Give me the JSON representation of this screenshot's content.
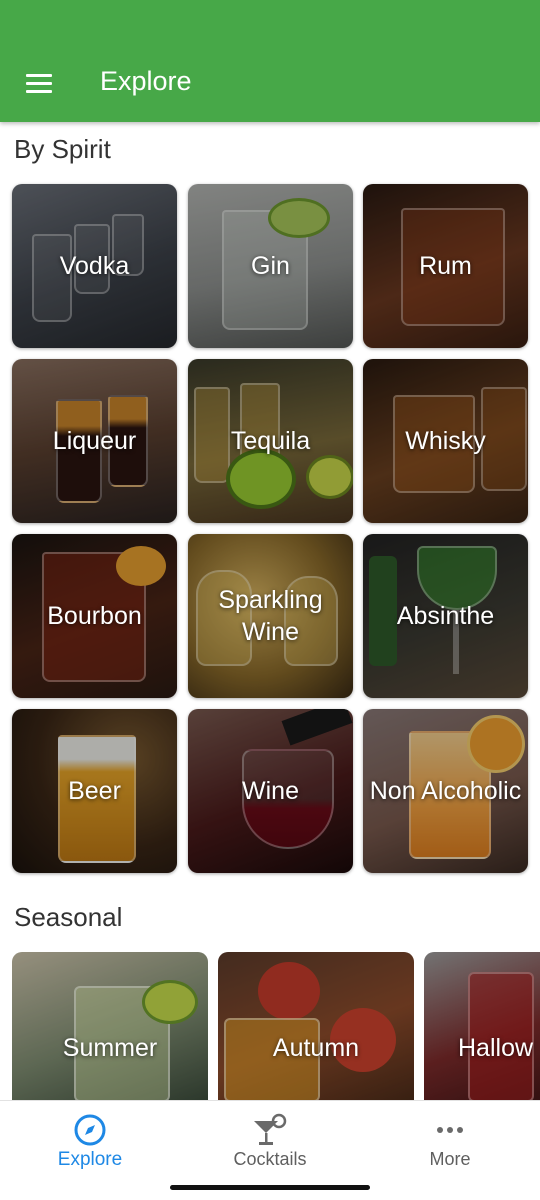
{
  "appbar": {
    "title": "Explore"
  },
  "sections": {
    "by_spirit": "By Spirit",
    "seasonal": "Seasonal"
  },
  "spirits": [
    {
      "label": "Vodka",
      "color": "#4a4f57"
    },
    {
      "label": "Gin",
      "color": "#8f9291"
    },
    {
      "label": "Rum",
      "color": "#5a2f1c"
    },
    {
      "label": "Liqueur",
      "color": "#5b4030"
    },
    {
      "label": "Tequila",
      "color": "#7a6a3a"
    },
    {
      "label": "Whisky",
      "color": "#5e3a1f"
    },
    {
      "label": "Bourbon",
      "color": "#4a2416"
    },
    {
      "label": "Sparkling Wine",
      "color": "#8a6a2a"
    },
    {
      "label": "Absinthe",
      "color": "#3b3a32"
    },
    {
      "label": "Beer",
      "color": "#7a5312"
    },
    {
      "label": "Wine",
      "color": "#4a1a1a"
    },
    {
      "label": "Non Alcoholic",
      "color": "#7a5a4e"
    }
  ],
  "seasonal": [
    {
      "label": "Summer",
      "color": "#7c8a6f"
    },
    {
      "label": "Autumn",
      "color": "#8a4a2a"
    },
    {
      "label": "Hallow",
      "color": "#7a2a2a"
    }
  ],
  "bottom_nav": {
    "explore": "Explore",
    "cocktails": "Cocktails",
    "more": "More",
    "active_color": "#1e88e5"
  }
}
